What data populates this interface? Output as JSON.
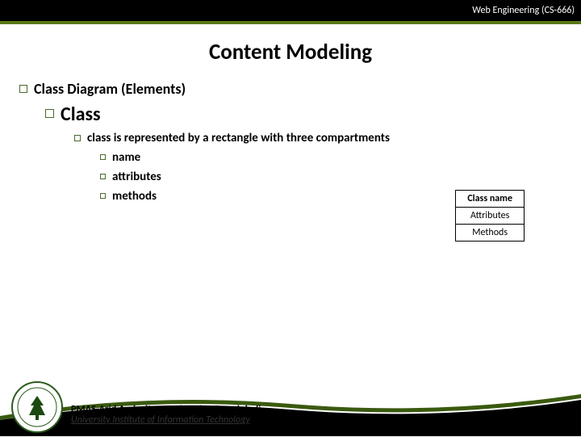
{
  "header": {
    "course": "Web Engineering (CS-666)"
  },
  "title": "Content Modeling",
  "outline": {
    "l1": "Class Diagram (Elements)",
    "l2": "Class",
    "l3_pre": "class is represented by a ",
    "l3_bold": "rectangle",
    "l3_post": " with three compartments",
    "l4a": "name",
    "l4b": "attributes",
    "l4c": "methods"
  },
  "diagram": {
    "row1": "Class name",
    "row2": "Attributes",
    "row3": "Methods"
  },
  "footer": {
    "line1": "PMAS-Arid Agriculture University, Rawalpindi",
    "line2": "University Institute of Information Technology"
  }
}
